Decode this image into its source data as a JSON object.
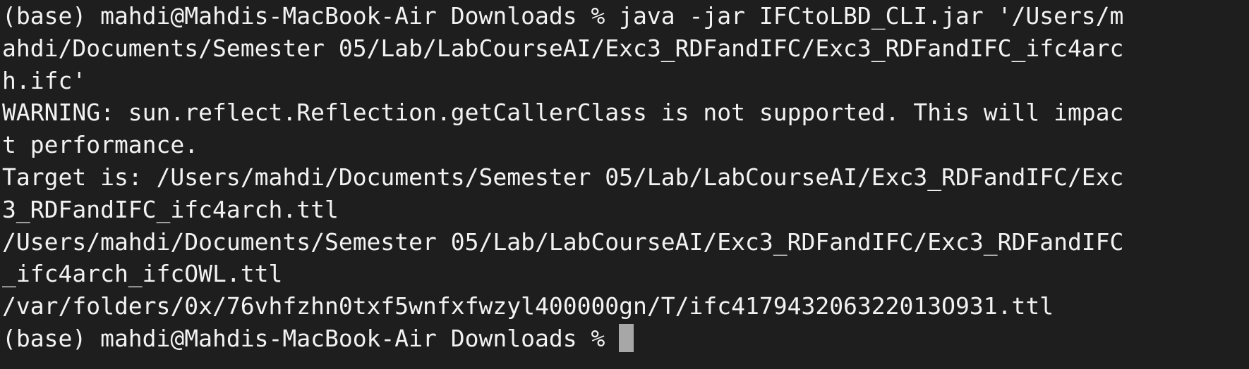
{
  "terminal": {
    "lines": [
      "(base) mahdi@Mahdis-MacBook-Air Downloads % java -jar IFCtoLBD_CLI.jar '/Users/m",
      "ahdi/Documents/Semester 05/Lab/LabCourseAI/Exc3_RDFandIFC/Exc3_RDFandIFC_ifc4arc",
      "h.ifc'",
      "WARNING: sun.reflect.Reflection.getCallerClass is not supported. This will impac",
      "t performance.",
      "Target is: /Users/mahdi/Documents/Semester 05/Lab/LabCourseAI/Exc3_RDFandIFC/Exc",
      "3_RDFandIFC_ifc4arch.ttl",
      "/Users/mahdi/Documents/Semester 05/Lab/LabCourseAI/Exc3_RDFandIFC/Exc3_RDFandIFC",
      "_ifc4arch_ifcOWL.ttl",
      "/var/folders/0x/76vhfzhn0txf5wnfxfwzyl400000gn/T/ifc417943206322013O931.ttl"
    ],
    "prompt": "(base) mahdi@Mahdis-MacBook-Air Downloads % "
  },
  "colors": {
    "background": "#1e1e1e",
    "foreground": "#f2f2f2",
    "cursor": "#a7a7a7"
  }
}
